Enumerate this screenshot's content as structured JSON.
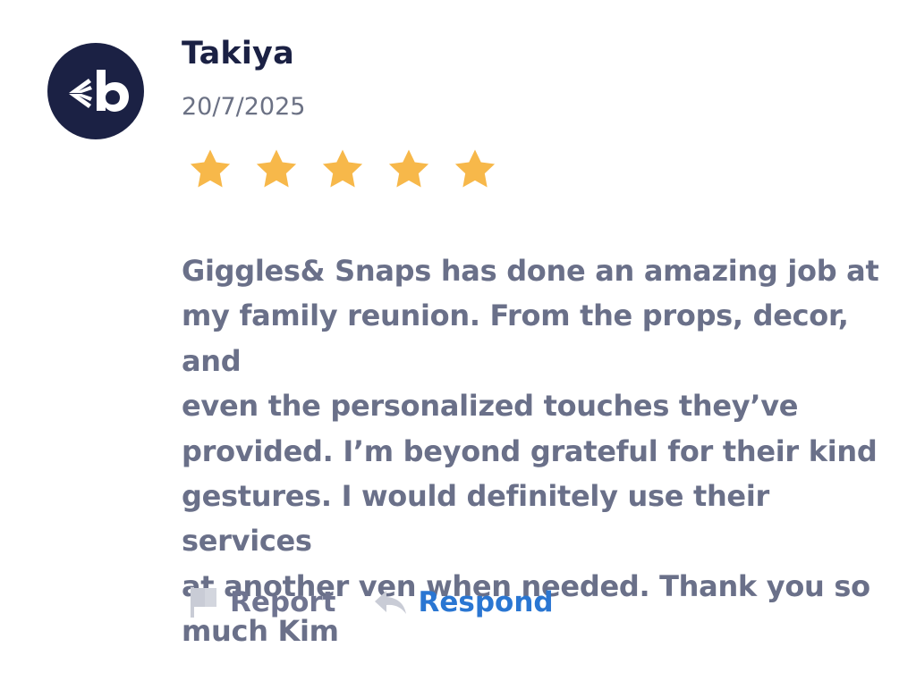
{
  "review": {
    "reviewer_name": "Takiya",
    "date": "20/7/2025",
    "rating": 5,
    "rating_max": 5,
    "text": "Giggles& Snaps has done an amazing job at\nmy family reunion. From the props, decor, and\neven the personalized touches they’ve\nprovided. I’m beyond grateful for their kind\ngestures. I would definitely use their services\nat another ven when needed. Thank you so\nmuch Kim"
  },
  "avatar": {
    "icon": "brand-logo-b-icon",
    "background_color": "#1b2144"
  },
  "actions": {
    "report_label": "Report",
    "report_icon": "flag-icon",
    "respond_label": "Respond",
    "respond_icon": "reply-arrow-icon"
  },
  "colors": {
    "star": "#f7b84a",
    "name": "#1b2144",
    "body_text": "#6a7089",
    "respond_link": "#2a76d2"
  }
}
